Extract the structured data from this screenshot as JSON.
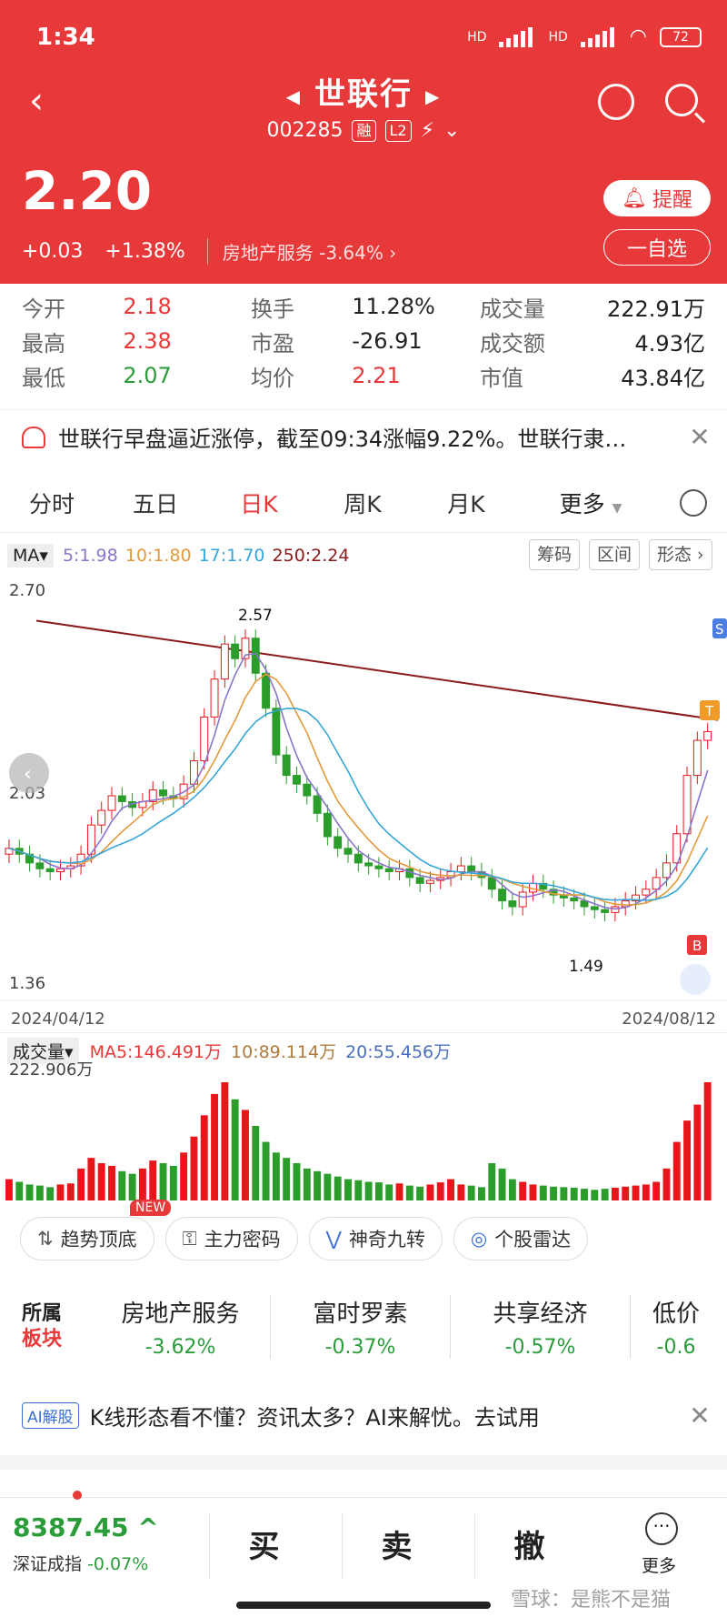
{
  "status": {
    "time": "1:34",
    "battery": "72",
    "hd1": "HD",
    "hd2": "HD"
  },
  "stock": {
    "name": "世联行",
    "code": "002285",
    "tag_margin": "融",
    "tag_l2": "L2",
    "price": "2.20",
    "change": "+0.03",
    "change_pct": "+1.38%",
    "sector": "房地产服务 -3.64% ›",
    "remind_label": "提醒",
    "watch_label": "一自选"
  },
  "stats": [
    [
      {
        "label": "今开",
        "value": "2.18",
        "tone": "red"
      },
      {
        "label": "换手",
        "value": "11.28%",
        "tone": ""
      },
      {
        "label": "成交量",
        "value": "222.91万",
        "tone": ""
      }
    ],
    [
      {
        "label": "最高",
        "value": "2.38",
        "tone": "red"
      },
      {
        "label": "市盈",
        "value": "-26.91",
        "tone": ""
      },
      {
        "label": "成交额",
        "value": "4.93亿",
        "tone": ""
      }
    ],
    [
      {
        "label": "最低",
        "value": "2.07",
        "tone": "green"
      },
      {
        "label": "均价",
        "value": "2.21",
        "tone": "red"
      },
      {
        "label": "市值",
        "value": "43.84亿",
        "tone": ""
      }
    ]
  ],
  "news": {
    "text": "世联行早盘逼近涨停，截至09:34涨幅9.22%。世联行隶…"
  },
  "tabs": [
    "分时",
    "五日",
    "日K",
    "周K",
    "月K",
    "更多"
  ],
  "ma": {
    "select": "MA",
    "ma5": "5:1.98",
    "ma10": "10:1.80",
    "ma17": "17:1.70",
    "ma250": "250:2.24"
  },
  "tools": [
    "筹码",
    "区间",
    "形态 ›"
  ],
  "chart_labels": {
    "y_top": "2.70",
    "y_mid": "2.03",
    "y_bottom": "1.36",
    "high_mark": "2.57",
    "low_mark": "1.49",
    "date_start": "2024/04/12",
    "date_end": "2024/08/12",
    "badge_s": "S",
    "badge_t": "T",
    "badge_b": "B"
  },
  "volume": {
    "label": "成交量",
    "ma5": "MA5:146.491万",
    "ma10": "10:89.114万",
    "ma20": "20:55.456万",
    "top": "222.906万"
  },
  "features": [
    {
      "label": "趋势顶底",
      "icon": "trend-icon",
      "glyph": "⇅"
    },
    {
      "label": "主力密码",
      "icon": "key-icon",
      "glyph": "⚿"
    },
    {
      "label": "神奇九转",
      "icon": "wave-icon",
      "glyph": "⋁"
    },
    {
      "label": "个股雷达",
      "icon": "radar-icon",
      "glyph": "◎"
    }
  ],
  "new_badge": "NEW",
  "plates": {
    "head": "所属",
    "head2": "板块",
    "items": [
      {
        "name": "房地产服务",
        "value": "-3.62%"
      },
      {
        "name": "富时罗素",
        "value": "-0.37%"
      },
      {
        "name": "共享经济",
        "value": "-0.57%"
      },
      {
        "name": "低价",
        "value": "-0.6"
      }
    ]
  },
  "ai": {
    "badge": "AI解股",
    "text": "K线形态看不懂？资讯太多？AI来解忧。去试用"
  },
  "footer": {
    "index_value": "8387.45 ^",
    "index_name": "深证成指",
    "index_change": "-0.07%",
    "buy": "买",
    "sell": "卖",
    "cancel": "撤",
    "more": "更多",
    "watermark": "雪球：是熊不是猫"
  },
  "chart_data": {
    "type": "candlestick",
    "x_start": "2024/04/12",
    "x_end": "2024/08/12",
    "ylim": [
      1.36,
      2.7
    ],
    "closes": [
      1.8,
      1.78,
      1.75,
      1.73,
      1.72,
      1.73,
      1.74,
      1.78,
      1.88,
      1.93,
      1.98,
      1.96,
      1.94,
      1.96,
      2.0,
      1.98,
      1.97,
      2.02,
      2.1,
      2.25,
      2.38,
      2.5,
      2.45,
      2.52,
      2.4,
      2.28,
      2.12,
      2.05,
      2.02,
      1.98,
      1.92,
      1.84,
      1.8,
      1.78,
      1.75,
      1.74,
      1.73,
      1.72,
      1.73,
      1.7,
      1.68,
      1.69,
      1.7,
      1.72,
      1.74,
      1.72,
      1.7,
      1.66,
      1.62,
      1.6,
      1.65,
      1.68,
      1.66,
      1.64,
      1.63,
      1.62,
      1.6,
      1.59,
      1.58,
      1.6,
      1.62,
      1.64,
      1.66,
      1.7,
      1.75,
      1.85,
      2.05,
      2.17,
      2.2
    ],
    "volume": [
      40,
      35,
      30,
      28,
      25,
      30,
      32,
      60,
      80,
      70,
      65,
      55,
      50,
      60,
      75,
      70,
      65,
      90,
      120,
      160,
      200,
      222,
      190,
      170,
      140,
      110,
      90,
      80,
      70,
      60,
      55,
      50,
      45,
      40,
      38,
      35,
      34,
      30,
      32,
      28,
      26,
      30,
      34,
      40,
      30,
      28,
      25,
      70,
      60,
      40,
      35,
      30,
      28,
      26,
      25,
      24,
      22,
      20,
      22,
      24,
      26,
      28,
      30,
      35,
      60,
      110,
      150,
      180,
      222
    ]
  }
}
